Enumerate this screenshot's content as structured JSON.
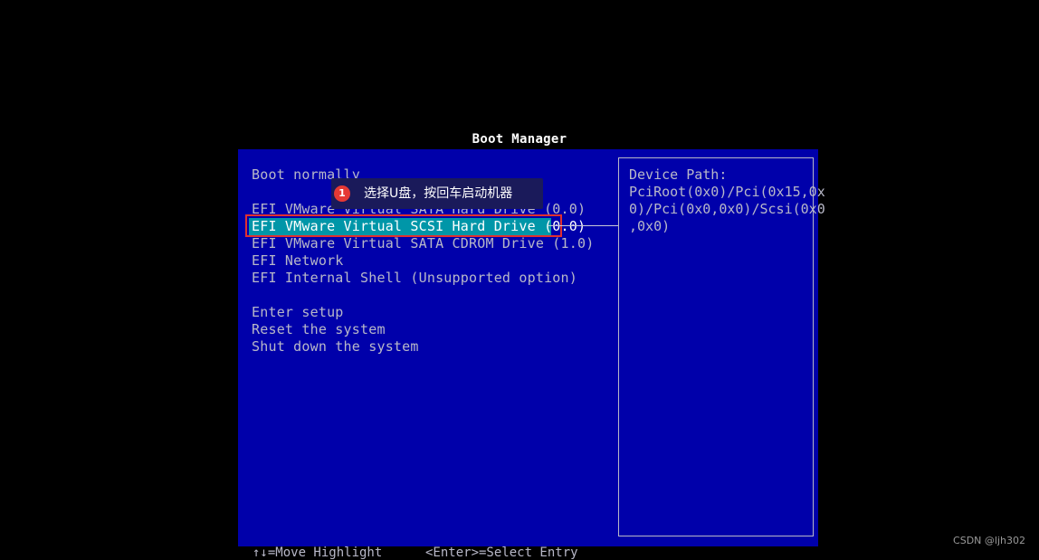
{
  "title": "Boot Manager",
  "menu": {
    "items": [
      "Boot normally",
      "EFI VMware Virtual SATA Hard Drive (0.0)",
      "EFI VMware Virtual SCSI Hard Drive (0.0)",
      "EFI VMware Virtual SATA CDROM Drive (1.0)",
      "EFI Network",
      "EFI Internal Shell (Unsupported option)",
      "Enter setup",
      "Reset the system",
      "Shut down the system"
    ],
    "selected_index": 2
  },
  "info_panel": {
    "heading": "Device Path:",
    "lines": [
      "PciRoot(0x0)/Pci(0x15,0x",
      "0)/Pci(0x0,0x0)/Scsi(0x0",
      ",0x0)"
    ]
  },
  "callout": {
    "number": "1",
    "text": "选择U盘，按回车启动机器"
  },
  "footer": {
    "hint_move": "↑↓=Move Highlight",
    "hint_select": "<Enter>=Select Entry"
  },
  "watermark": "CSDN @ljh302",
  "colors": {
    "background": "#0000aa",
    "highlight": "#0096a8",
    "annotation_border": "#e03030"
  }
}
